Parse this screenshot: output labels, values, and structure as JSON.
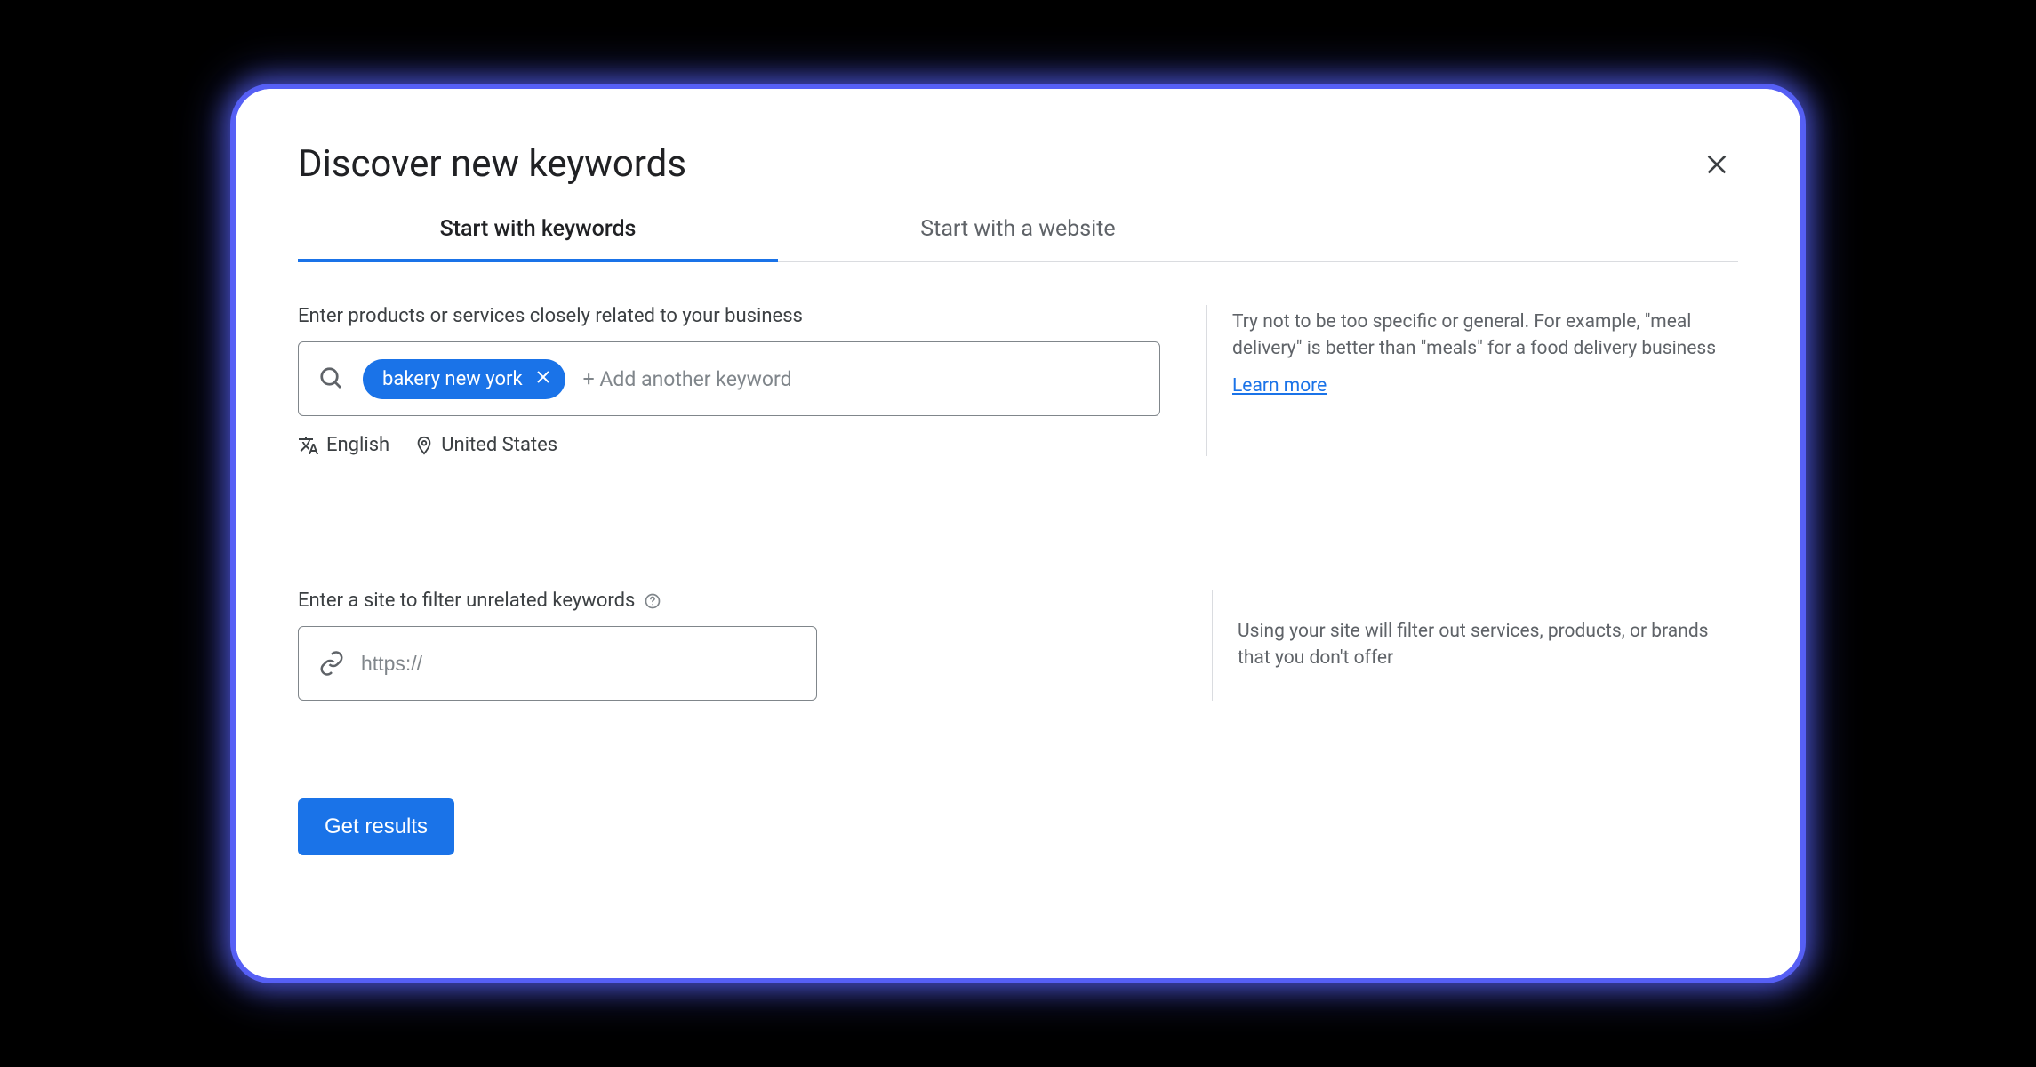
{
  "header": {
    "title": "Discover new keywords"
  },
  "tabs": [
    {
      "label": "Start with keywords",
      "active": true
    },
    {
      "label": "Start with a website",
      "active": false
    }
  ],
  "keywords_section": {
    "label": "Enter products or services closely related to your business",
    "chip": "bakery new york",
    "add_placeholder": "+ Add another keyword",
    "language": "English",
    "location": "United States",
    "tip": "Try not to be too specific or general. For example, \"meal delivery\" is better than \"meals\" for a food delivery business",
    "learn_more": "Learn more"
  },
  "site_section": {
    "label": "Enter a site to filter unrelated keywords",
    "placeholder": "https://",
    "tip": "Using your site will filter out services, products, or brands that you don't offer"
  },
  "submit": {
    "label": "Get results"
  }
}
